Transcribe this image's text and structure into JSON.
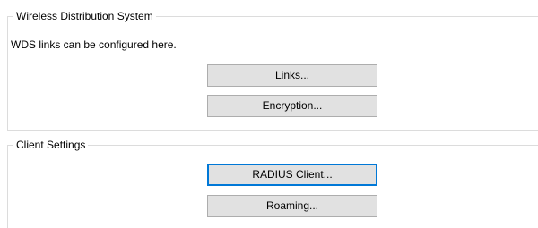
{
  "wds_group": {
    "title": "Wireless Distribution System",
    "description": "WDS links can be configured here.",
    "links_button": "Links...",
    "encryption_button": "Encryption..."
  },
  "client_group": {
    "title": "Client Settings",
    "radius_button": "RADIUS Client...",
    "roaming_button": "Roaming..."
  },
  "colors": {
    "button_face": "#e1e1e1",
    "button_border": "#adadad",
    "focus_border": "#0078d7",
    "group_border": "#dcdcdc"
  }
}
